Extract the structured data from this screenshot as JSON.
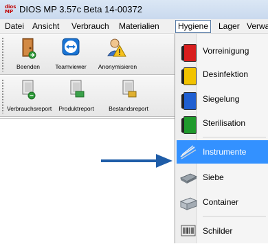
{
  "window": {
    "title": "DIOS MP 3.57c Beta 14-00372",
    "app_icon_text_top": "dios",
    "app_icon_text_bottom": "MP"
  },
  "menubar": {
    "items": [
      "Datei",
      "Ansicht",
      "Verbrauch",
      "Materialien",
      "Hygiene",
      "Lager",
      "Verwa"
    ],
    "active": "Hygiene"
  },
  "toolbar1": {
    "buttons": [
      {
        "label": "Beenden",
        "icon": "exit-door-icon"
      },
      {
        "label": "Teamviewer",
        "icon": "teamviewer-icon"
      },
      {
        "label": "Anonymisieren",
        "icon": "anonymize-user-icon"
      }
    ]
  },
  "toolbar2": {
    "buttons": [
      {
        "label": "Verbrauchsreport",
        "icon": "report-icon"
      },
      {
        "label": "Produktreport",
        "icon": "report-icon"
      },
      {
        "label": "Bestandsreport",
        "icon": "report-icon"
      }
    ]
  },
  "hygiene_menu": {
    "items": [
      {
        "label": "Vorreinigung",
        "icon": "red-book-icon",
        "color": "#d81e1e"
      },
      {
        "label": "Desinfektion",
        "icon": "yellow-book-icon",
        "color": "#f2c300"
      },
      {
        "label": "Siegelung",
        "icon": "blue-book-icon",
        "color": "#1f5fd1"
      },
      {
        "label": "Sterilisation",
        "icon": "green-book-icon",
        "color": "#1f9a2c"
      },
      {
        "label": "Instrumente",
        "icon": "instruments-icon",
        "highlighted": true
      },
      {
        "label": "Siebe",
        "icon": "tray-icon"
      },
      {
        "label": "Container",
        "icon": "container-icon"
      },
      {
        "label": "Schilder",
        "icon": "barcode-label-icon"
      }
    ],
    "highlight_color": "#3391ff"
  },
  "annotation": {
    "arrow_color": "#1f5da8",
    "icon": "pointer-arrow-icon"
  }
}
